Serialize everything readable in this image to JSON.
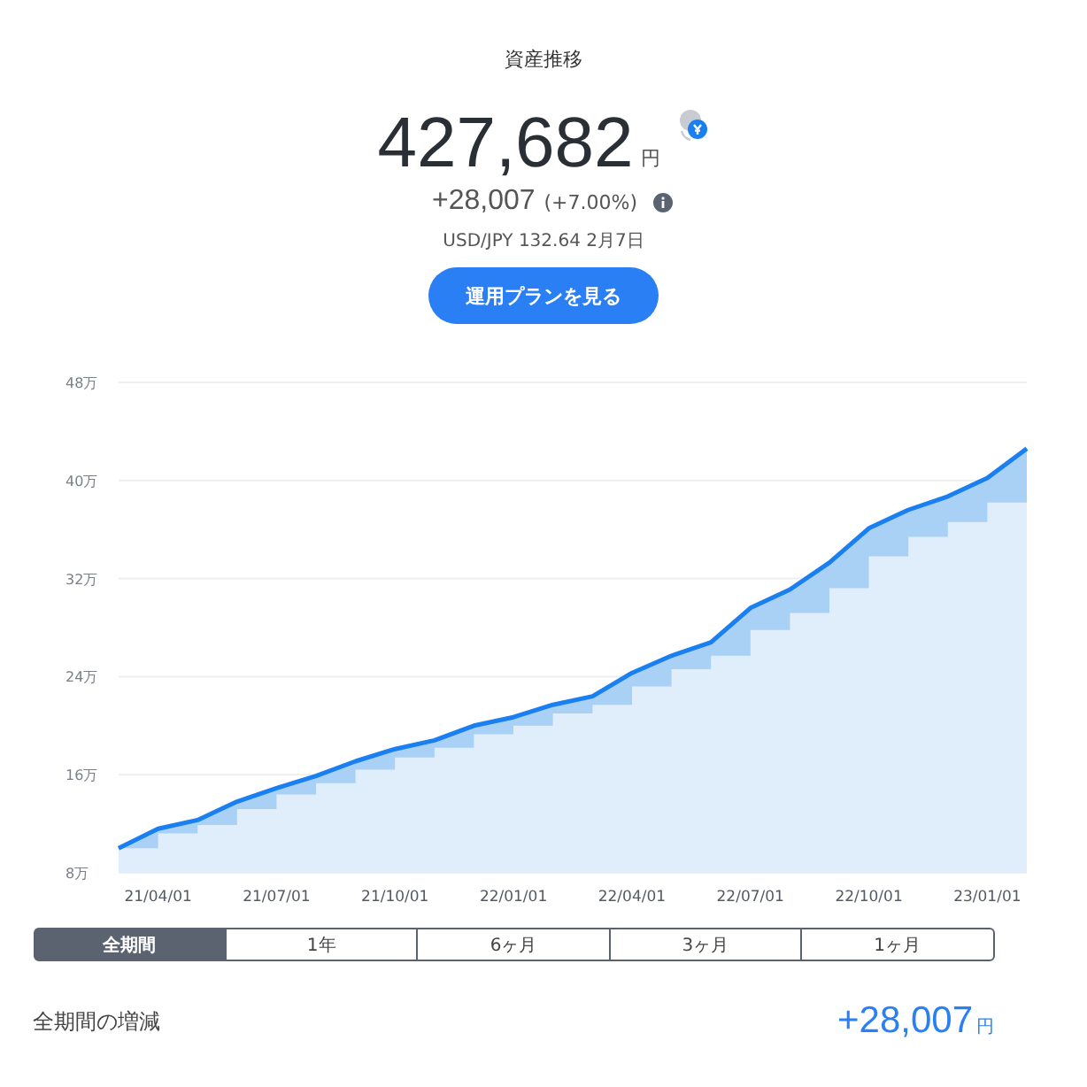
{
  "title": "資産推移",
  "total": {
    "amount": "427,682",
    "unit": "円"
  },
  "change": {
    "amount": "+28,007",
    "percent": "(+7.00%)"
  },
  "rate": "USD/JPY 132.64 2月7日",
  "plan_button": "運用プランを見る",
  "chart_data": {
    "type": "area",
    "categories": [
      null,
      "21/04/01",
      null,
      null,
      "21/07/01",
      null,
      null,
      "21/10/01",
      null,
      null,
      "22/01/01",
      null,
      null,
      "22/04/01",
      null,
      null,
      "22/07/01",
      null,
      null,
      "22/10/01",
      null,
      null,
      "23/01/01",
      null
    ],
    "series": [
      {
        "color": "#1a7ff0",
        "values": [
          10.0,
          11.6,
          12.3,
          13.8,
          14.9,
          15.9,
          17.1,
          18.1,
          18.8,
          20.0,
          20.7,
          21.7,
          22.4,
          24.3,
          25.7,
          26.8,
          29.6,
          31.1,
          33.3,
          36.1,
          37.6,
          38.7,
          40.2,
          42.6
        ]
      },
      {
        "color": "#e0edfb",
        "values": [
          10.0,
          11.2,
          11.9,
          13.2,
          14.4,
          15.3,
          16.4,
          17.4,
          18.2,
          19.3,
          20.0,
          21.0,
          21.7,
          23.2,
          24.6,
          25.7,
          27.8,
          29.2,
          31.2,
          33.8,
          35.4,
          36.6,
          38.2,
          40.4
        ]
      }
    ],
    "ylim": [
      8,
      48
    ],
    "grid": true,
    "yticks": [
      {
        "value": 8,
        "label": "8万"
      },
      {
        "value": 16,
        "label": "16万"
      },
      {
        "value": 24,
        "label": "24万"
      },
      {
        "value": 32,
        "label": "32万"
      },
      {
        "value": 40,
        "label": "40万"
      },
      {
        "value": 48,
        "label": "48万"
      }
    ]
  },
  "periods": [
    {
      "label": "全期間",
      "selected": true
    },
    {
      "label": "1年",
      "selected": false
    },
    {
      "label": "6ヶ月",
      "selected": false
    },
    {
      "label": "3ヶ月",
      "selected": false
    },
    {
      "label": "1ヶ月",
      "selected": false
    }
  ],
  "summary": {
    "label": "全期間の増減",
    "amount": "+28,007",
    "unit": "円"
  }
}
